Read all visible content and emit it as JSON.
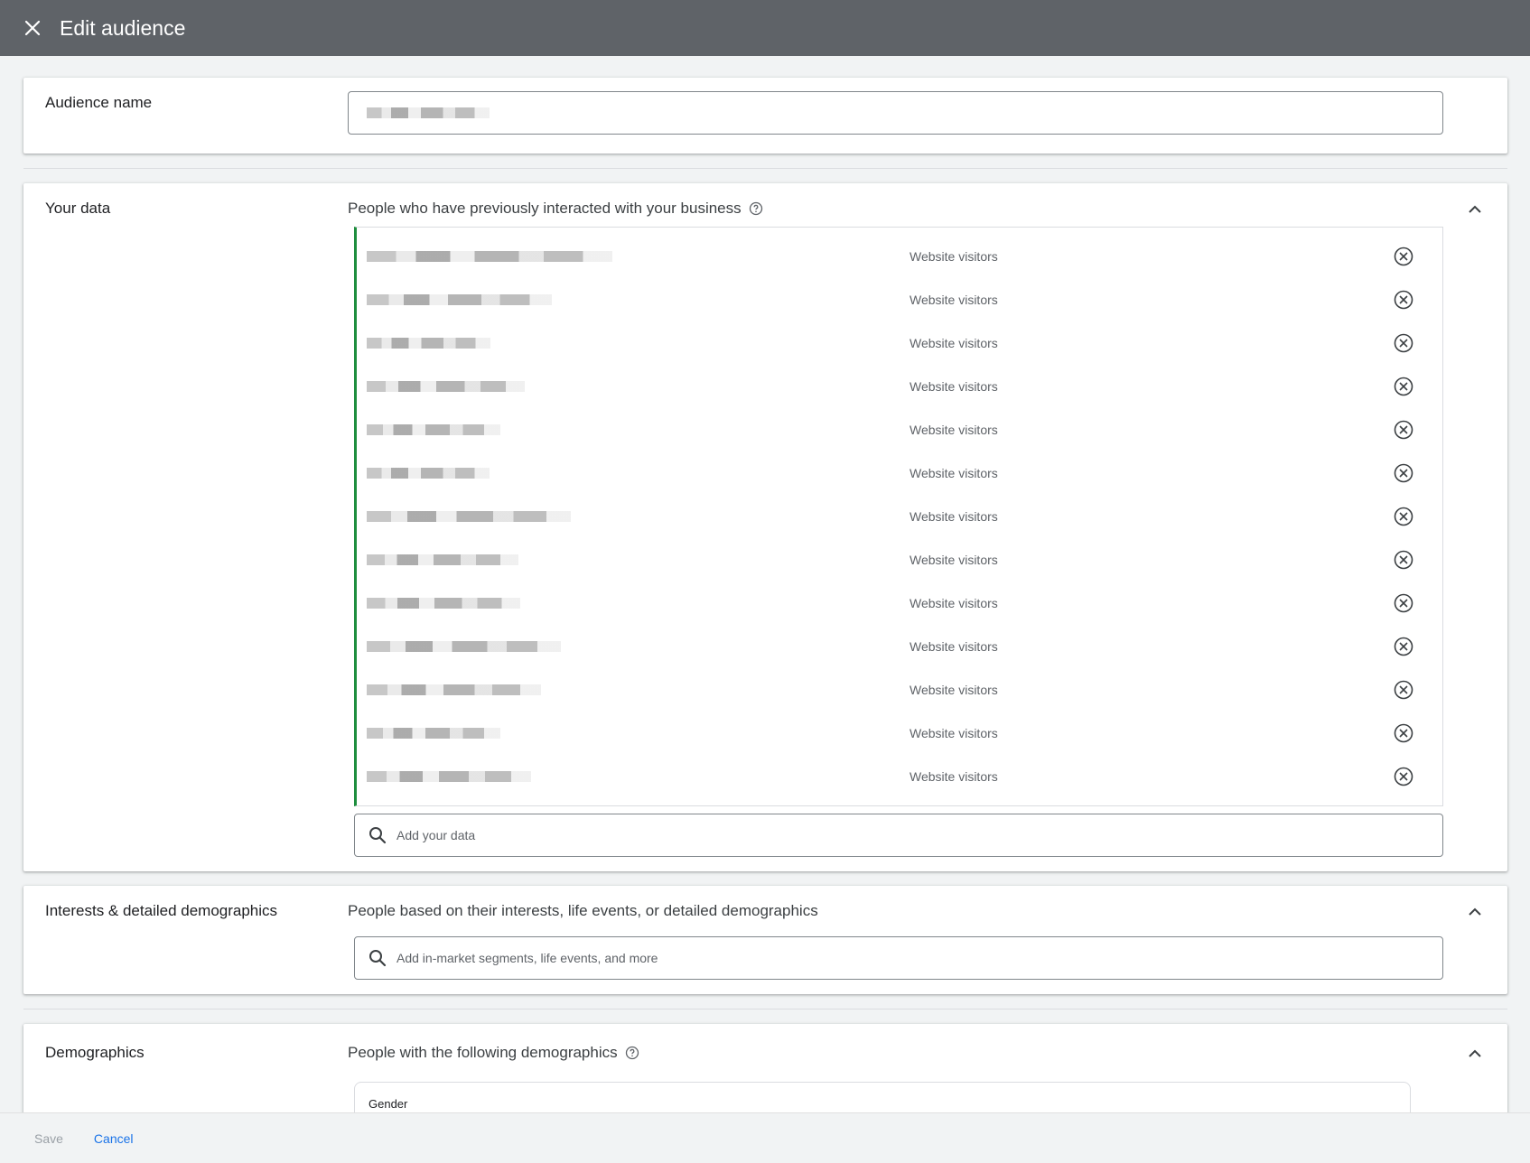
{
  "header": {
    "title": "Edit audience",
    "close_icon": "close-icon"
  },
  "audience_name": {
    "label": "Audience name",
    "value": ""
  },
  "your_data": {
    "label": "Your data",
    "description": "People who have previously interacted with your business",
    "items": [
      {
        "name": "",
        "type": "Website visitors"
      },
      {
        "name": "",
        "type": "Website visitors"
      },
      {
        "name": "",
        "type": "Website visitors"
      },
      {
        "name": "",
        "type": "Website visitors"
      },
      {
        "name": "",
        "type": "Website visitors"
      },
      {
        "name": "",
        "type": "Website visitors"
      },
      {
        "name": "",
        "type": "Website visitors"
      },
      {
        "name": "",
        "type": "Website visitors"
      },
      {
        "name": "",
        "type": "Website visitors"
      },
      {
        "name": "",
        "type": "Website visitors"
      },
      {
        "name": "",
        "type": "Website visitors"
      },
      {
        "name": "",
        "type": "Website visitors"
      },
      {
        "name": "",
        "type": "Website visitors"
      }
    ],
    "search_placeholder": "Add your data"
  },
  "interests": {
    "label": "Interests & detailed demographics",
    "description": "People based on their interests, life events, or detailed demographics",
    "search_placeholder": "Add in-market segments, life events, and more"
  },
  "demographics": {
    "label": "Demographics",
    "description": "People with the following demographics",
    "gender_label": "Gender"
  },
  "footer": {
    "save_label": "Save",
    "cancel_label": "Cancel"
  },
  "colors": {
    "header_bg": "#5f6368",
    "accent": "#1a73e8",
    "list_border": "#1e8e3e"
  }
}
